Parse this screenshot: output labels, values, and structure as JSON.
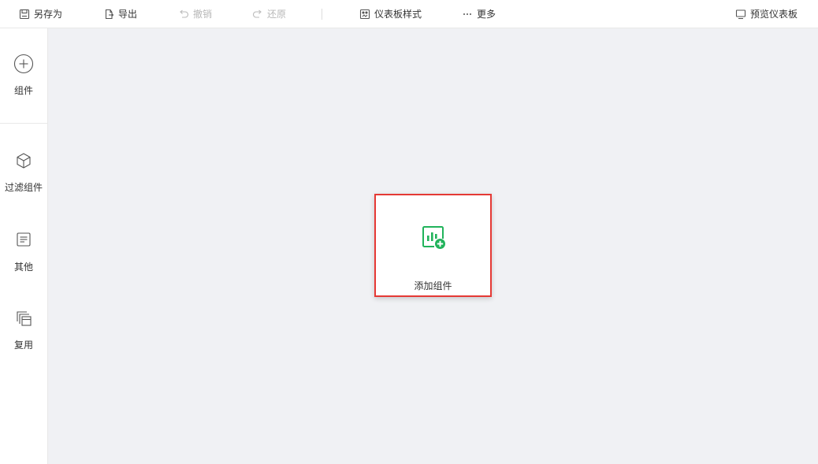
{
  "toolbar": {
    "save_as": "另存为",
    "export": "导出",
    "undo": "撤销",
    "redo": "还原",
    "dashboard_style": "仪表板样式",
    "more": "更多",
    "preview": "预览仪表板"
  },
  "sidebar": {
    "items": [
      {
        "label": "组件",
        "icon": "plus-circle-icon"
      },
      {
        "label": "过滤组件",
        "icon": "cube-icon"
      },
      {
        "label": "其他",
        "icon": "document-icon"
      },
      {
        "label": "复用",
        "icon": "layers-icon"
      }
    ]
  },
  "canvas": {
    "add_component_label": "添加组件",
    "add_component_icon": "chart-add-icon"
  },
  "colors": {
    "accent_green": "#21b35b",
    "highlight_red": "#e53935",
    "canvas_bg": "#f0f1f4"
  }
}
